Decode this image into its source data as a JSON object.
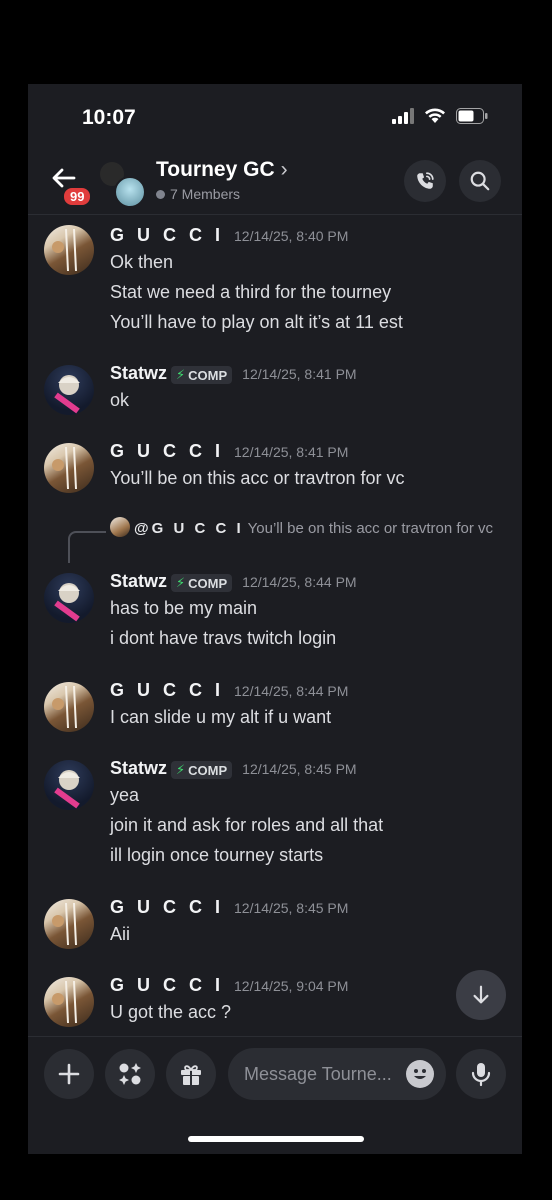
{
  "status_bar": {
    "time": "10:07"
  },
  "header": {
    "badge_count": "99",
    "title": "Tourney GC",
    "chevron": "›",
    "members": "7 Members",
    "icons": [
      "back-arrow-icon",
      "phone-call-icon",
      "search-icon"
    ]
  },
  "messages": [
    {
      "author": "G U C C I",
      "timestamp": "12/14/25, 8:40 PM",
      "lines": [
        "Ok then",
        "Stat we need a third for the tourney",
        "You’ll have to play on alt it’s at 11 est"
      ]
    },
    {
      "author": "Statwz",
      "tag": "COMP",
      "timestamp": "12/14/25, 8:41 PM",
      "lines": [
        "ok"
      ]
    },
    {
      "author": "G U C C I",
      "timestamp": "12/14/25, 8:41 PM",
      "lines": [
        "You’ll be on this acc or travtron for vc"
      ]
    },
    {
      "reply_to": "@G U C C I",
      "reply_preview": "You’ll be on this acc or travtron for vc",
      "author": "Statwz",
      "tag": "COMP",
      "timestamp": "12/14/25, 8:44 PM",
      "lines": [
        "has to be my main",
        "i dont have travs twitch login"
      ]
    },
    {
      "author": "G U C C I",
      "timestamp": "12/14/25, 8:44 PM",
      "lines": [
        "I can slide u my alt if u want"
      ]
    },
    {
      "author": "Statwz",
      "tag": "COMP",
      "timestamp": "12/14/25, 8:45 PM",
      "lines": [
        "yea",
        "join it and ask for roles and all that",
        "ill login once tourney starts"
      ]
    },
    {
      "author": "G U C C I",
      "timestamp": "12/14/25, 8:45 PM",
      "lines": [
        "Aii"
      ]
    },
    {
      "author": "G U C C I",
      "timestamp": "12/14/25, 9:04 PM",
      "lines": [
        "U got the acc ?"
      ]
    }
  ],
  "composer": {
    "placeholder": "Message Tourne...",
    "icons": [
      "plus-icon",
      "apps-icon",
      "gift-icon",
      "emoji-icon",
      "microphone-icon"
    ]
  },
  "colors": {
    "background": "#1c1d22",
    "surface": "#2b2d33",
    "badge": "#e03c3c",
    "tag_bolt": "#3ed86e"
  }
}
